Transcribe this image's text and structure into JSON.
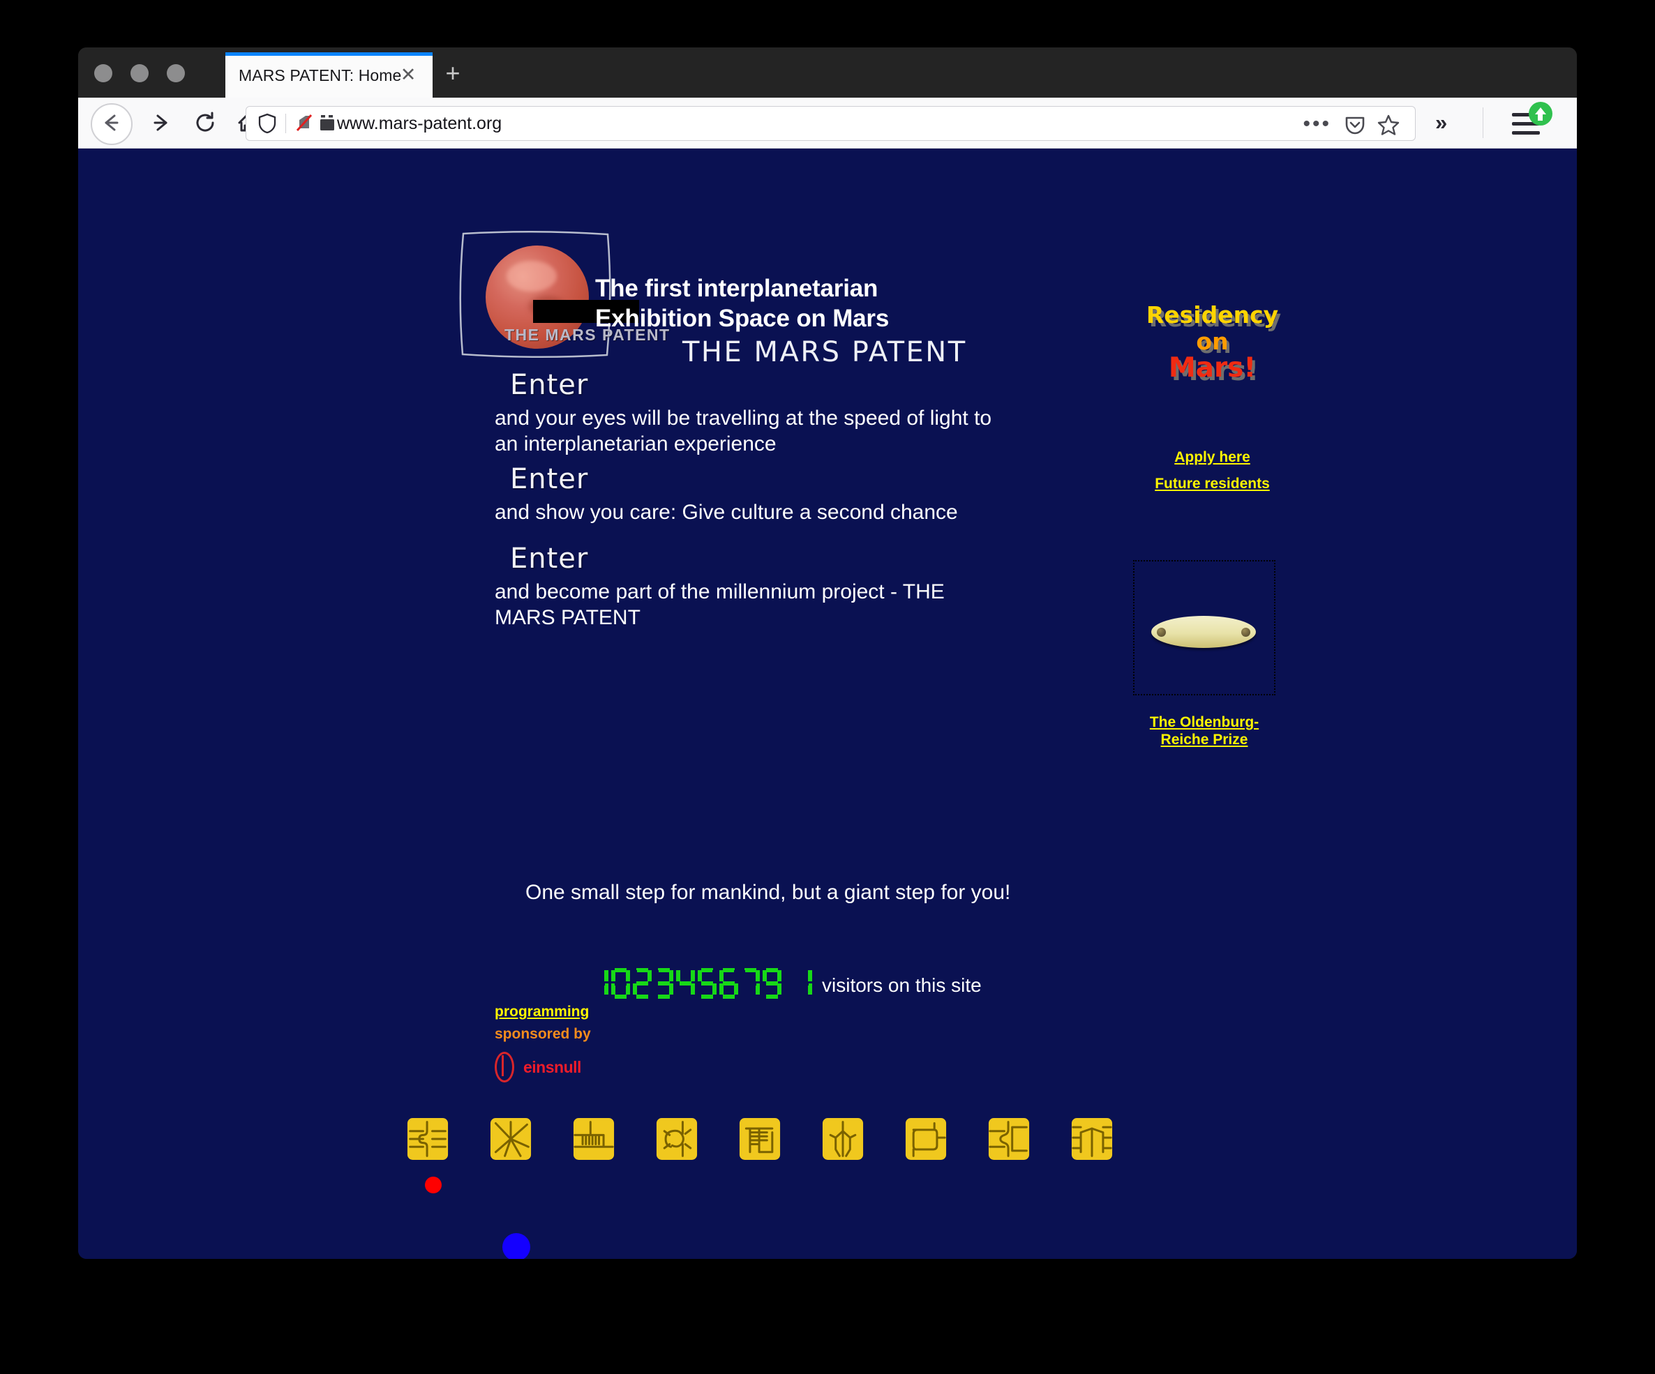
{
  "browser": {
    "tab_title": "MARS PATENT: Home",
    "tab_close_label": "✕",
    "new_tab_label": "+",
    "url": "www.mars-patent.org",
    "overflow_label": "»",
    "ellipsis_label": "•••",
    "accent_color": "#0a84ff"
  },
  "page": {
    "background_color": "#0a1152",
    "logo": {
      "caption": "THE MARS PATENT"
    },
    "headline": {
      "line1": "The first interplanetarian",
      "line2": "Exhibition Space on Mars",
      "line3": "THE MARS PATENT"
    },
    "enter_blocks": [
      {
        "word": "Enter",
        "text": "and your eyes will be travelling at the speed of light to an interplanetarian experience"
      },
      {
        "word": "Enter",
        "text": "and show you care: Give culture a second chance"
      },
      {
        "word": "Enter",
        "text": "and become part of the millennium project - THE MARS PATENT"
      }
    ],
    "tagline": "One small step for mankind, but a giant step for you!",
    "counter": {
      "digits": "102345679",
      "trailing_digit": "1",
      "label": "visitors on this site",
      "display_color": "#17d817"
    },
    "sponsor": {
      "programming": "programming",
      "sponsored_by": "sponsored by",
      "sponsor_name": "einsnull",
      "programming_color": "#fdf500",
      "sponsored_by_color": "#f48b1d",
      "sponsor_name_color": "#ee1c2a"
    },
    "sidebar": {
      "residency": {
        "line1": "Residency",
        "line2": "on",
        "line3": "Mars!",
        "line1_color": "#ffd400",
        "line2_color": "#ff9c00",
        "line3_color": "#f02b12"
      },
      "apply_link": "Apply here",
      "future_link": "Future residents",
      "prize_caption": "The Oldenburg-Reiche Prize",
      "link_color": "#fdf500"
    },
    "chips": {
      "count": 9,
      "color": "#f0c81e",
      "names": [
        "chip-contacts-1",
        "chip-contacts-2",
        "chip-contacts-3",
        "chip-contacts-4",
        "chip-contacts-5",
        "chip-contacts-6",
        "chip-contacts-7",
        "chip-contacts-8",
        "chip-contacts-9"
      ]
    },
    "markers": {
      "red_dot_color": "#fe0000",
      "blue_dot_color": "#1400ff"
    }
  }
}
